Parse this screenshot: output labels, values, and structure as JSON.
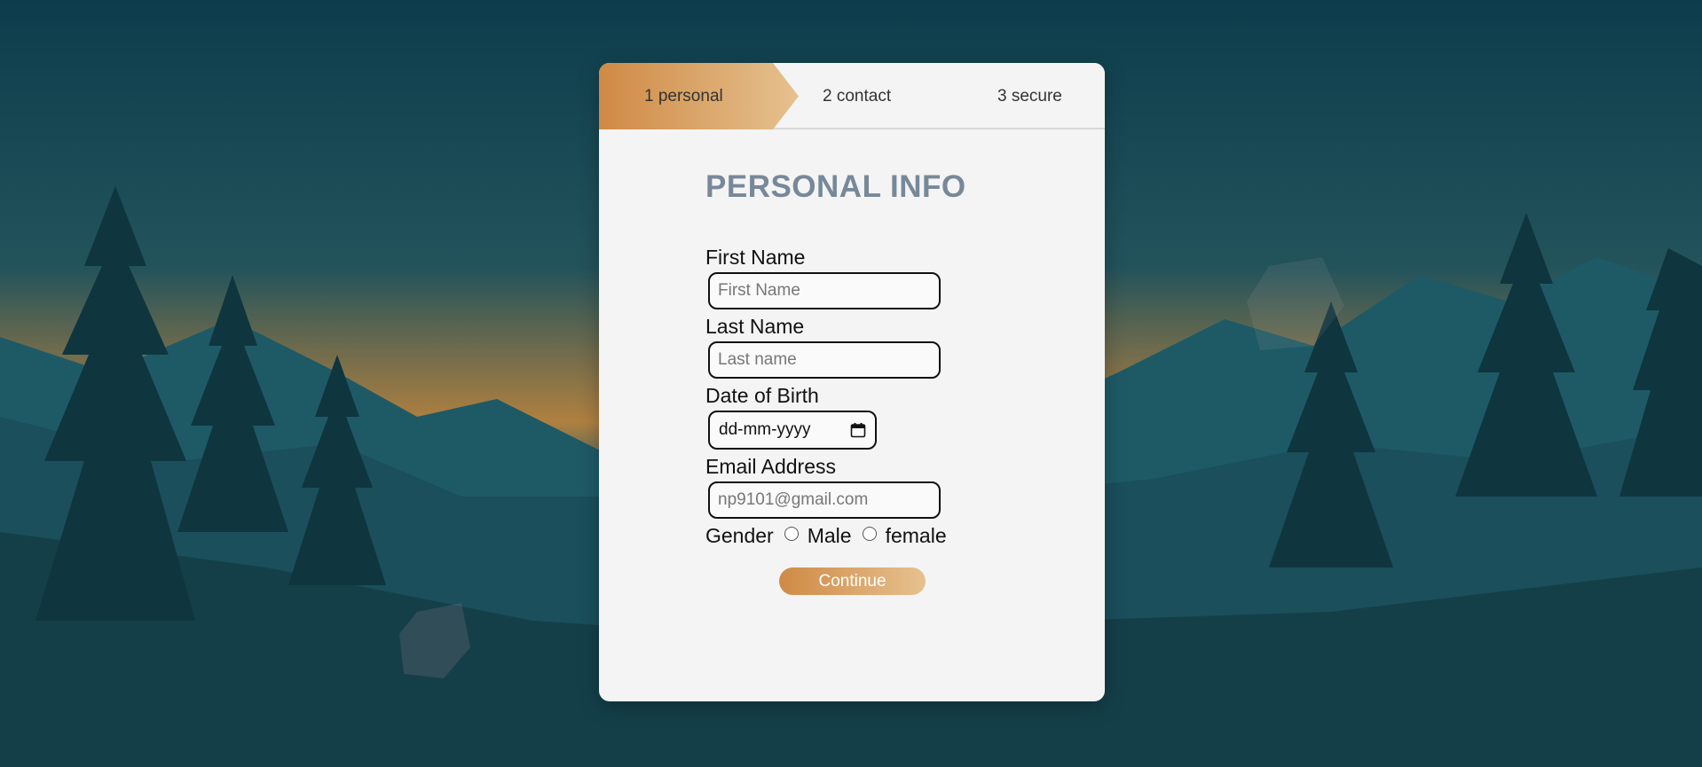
{
  "steps": [
    {
      "label": "1 personal",
      "active": true
    },
    {
      "label": "2 contact",
      "active": false
    },
    {
      "label": "3 secure",
      "active": false
    }
  ],
  "form": {
    "title": "PERSONAL INFO",
    "first_name": {
      "label": "First Name",
      "placeholder": "First Name"
    },
    "last_name": {
      "label": "Last Name",
      "placeholder": "Last name"
    },
    "dob": {
      "label": "Date of Birth",
      "placeholder": "dd-mm-yyyy"
    },
    "email": {
      "label": "Email Address",
      "placeholder": "np9101@gmail.com"
    },
    "gender": {
      "label": "Gender",
      "options": [
        "Male",
        "female"
      ]
    },
    "continue_label": "Continue"
  },
  "colors": {
    "accent_start": "#cf8a45",
    "accent_end": "#e6c18f",
    "title": "#778899",
    "card": "#f4f4f4",
    "background": "#123d48"
  }
}
